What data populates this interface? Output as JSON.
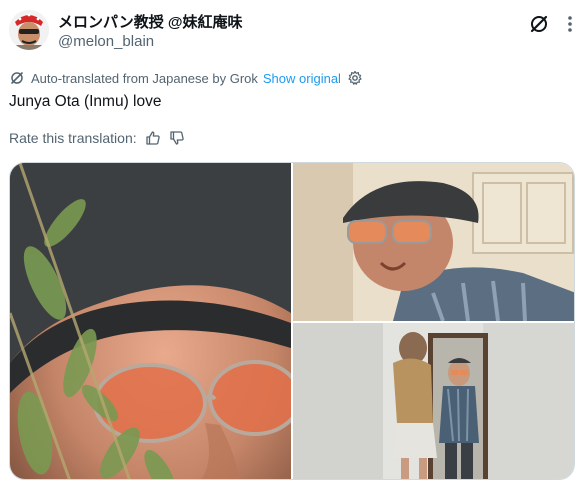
{
  "post": {
    "display_name": "メロンパン教授 @妹紅庵味",
    "handle": "@melon_blain",
    "text": "Junya Ota (Inmu) love"
  },
  "translation": {
    "note": "Auto-translated from Japanese by Grok",
    "show_original": "Show original",
    "rate_prompt": "Rate this translation:"
  },
  "icons": {
    "grok": "grok-icon",
    "more": "more-icon",
    "translate": "translate-icon",
    "settings": "gear-icon",
    "like": "thumbs-up-icon",
    "dislike": "thumbs-down-icon"
  },
  "colors": {
    "text": "#0f1419",
    "secondary": "#536471",
    "link": "#1d9bf0",
    "border": "#cfd9de"
  },
  "media": {
    "count": 3
  }
}
